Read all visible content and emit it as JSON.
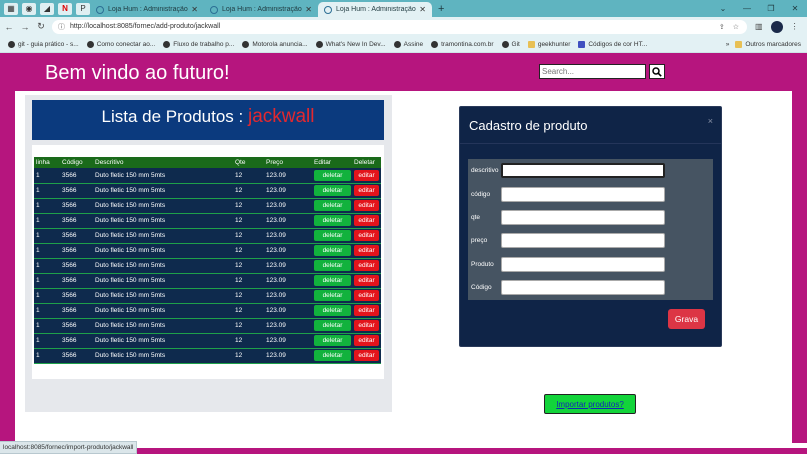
{
  "browser": {
    "tabs": [
      {
        "title": "Loja Hum : Administração",
        "active": false
      },
      {
        "title": "Loja Hum : Administração",
        "active": false
      },
      {
        "title": "Loja Hum : Administração",
        "active": true
      }
    ],
    "url": "http://localhost:8085/fornec/add-produto/jackwall",
    "bookmarks": [
      "git - guia prático - s...",
      "Como conectar ao...",
      "Fluxo de trabalho p...",
      "Motorola anuncia...",
      "What's New In Dev...",
      "Assine",
      "tramontina.com.br",
      "Git",
      "geekhunter",
      "Códigos de cor HT..."
    ],
    "bookmarks_more": "»",
    "other_bookmarks": "Outros marcadores",
    "status_url": "localhost:8085/fornec/import-produto/jackwall"
  },
  "header": {
    "welcome": "Bem vindo ao futuro!",
    "search_placeholder": "Search..."
  },
  "list": {
    "title": "Lista de Produtos : ",
    "user": "jackwall",
    "columns": [
      "linha",
      "Código",
      "Descritivo",
      "Qte",
      "Preço",
      "Editar",
      "Deletar"
    ],
    "rows": [
      {
        "linha": "1",
        "codigo": "3566",
        "descritivo": "Duto fletic 150 mm 5mts",
        "qte": "12",
        "preco": "123.09",
        "del": "deletar",
        "edit": "editar"
      },
      {
        "linha": "1",
        "codigo": "3566",
        "descritivo": "Duto fletic 150 mm 5mts",
        "qte": "12",
        "preco": "123.09",
        "del": "deletar",
        "edit": "editar"
      },
      {
        "linha": "1",
        "codigo": "3566",
        "descritivo": "Duto fletic 150 mm 5mts",
        "qte": "12",
        "preco": "123.09",
        "del": "deletar",
        "edit": "editar"
      },
      {
        "linha": "1",
        "codigo": "3566",
        "descritivo": "Duto fletic 150 mm 5mts",
        "qte": "12",
        "preco": "123.09",
        "del": "deletar",
        "edit": "editar"
      },
      {
        "linha": "1",
        "codigo": "3566",
        "descritivo": "Duto fletic 150 mm 5mts",
        "qte": "12",
        "preco": "123.09",
        "del": "deletar",
        "edit": "editar"
      },
      {
        "linha": "1",
        "codigo": "3566",
        "descritivo": "Duto fletic 150 mm 5mts",
        "qte": "12",
        "preco": "123.09",
        "del": "deletar",
        "edit": "editar"
      },
      {
        "linha": "1",
        "codigo": "3566",
        "descritivo": "Duto fletic 150 mm 5mts",
        "qte": "12",
        "preco": "123.09",
        "del": "deletar",
        "edit": "editar"
      },
      {
        "linha": "1",
        "codigo": "3566",
        "descritivo": "Duto fletic 150 mm 5mts",
        "qte": "12",
        "preco": "123.09",
        "del": "deletar",
        "edit": "editar"
      },
      {
        "linha": "1",
        "codigo": "3566",
        "descritivo": "Duto fletic 150 mm 5mts",
        "qte": "12",
        "preco": "123.09",
        "del": "deletar",
        "edit": "editar"
      },
      {
        "linha": "1",
        "codigo": "3566",
        "descritivo": "Duto fletic 150 mm 5mts",
        "qte": "12",
        "preco": "123.09",
        "del": "deletar",
        "edit": "editar"
      },
      {
        "linha": "1",
        "codigo": "3566",
        "descritivo": "Duto fletic 150 mm 5mts",
        "qte": "12",
        "preco": "123.09",
        "del": "deletar",
        "edit": "editar"
      },
      {
        "linha": "1",
        "codigo": "3566",
        "descritivo": "Duto fletic 150 mm 5mts",
        "qte": "12",
        "preco": "123.09",
        "del": "deletar",
        "edit": "editar"
      },
      {
        "linha": "1",
        "codigo": "3566",
        "descritivo": "Duto fletic 150 mm 5mts",
        "qte": "12",
        "preco": "123.09",
        "del": "deletar",
        "edit": "editar"
      }
    ]
  },
  "modal": {
    "title": "Cadastro de produto",
    "close": "×",
    "fields": [
      "descritivo",
      "código",
      "qte",
      "preço",
      "Produto",
      "Código"
    ],
    "submit": "Grava"
  },
  "import_button": "Importar produtos?",
  "colors": {
    "page_bg": "#b6157e",
    "list_header": "#0b3a7e",
    "user_accent": "#e3282f",
    "table_head": "#1a6a1a",
    "row_bg": "#0e2a4d",
    "delete_btn": "#12b23d",
    "edit_btn": "#e3141c",
    "modal_bg": "#0f2447",
    "grava_btn": "#dc3545",
    "import_btn": "#12d43a"
  }
}
